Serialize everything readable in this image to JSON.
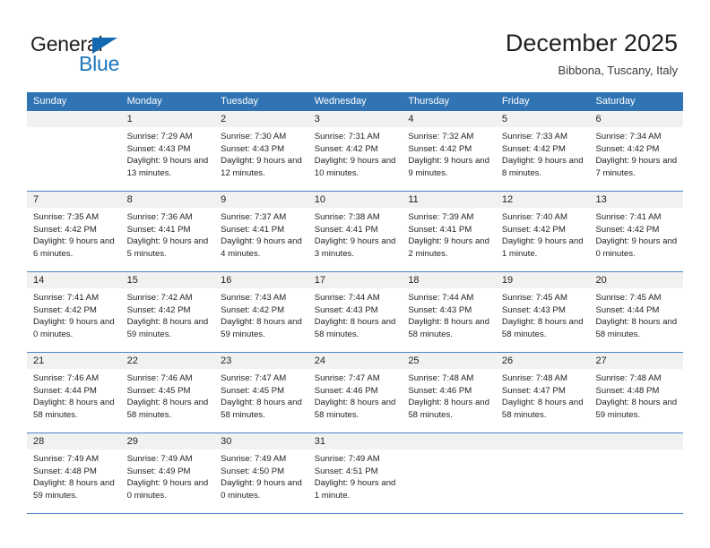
{
  "brand": {
    "name_part1": "General",
    "name_part2": "Blue",
    "triangle_color": "#1268b3",
    "blue_color": "#1b75bb"
  },
  "header": {
    "title": "December 2025",
    "subtitle": "Bibbona, Tuscany, Italy"
  },
  "colors": {
    "header_row_bg": "#3174b4",
    "date_band_bg": "#f1f1f1",
    "row_separator": "#4a86c5",
    "text": "#231f20"
  },
  "weekdays": [
    "Sunday",
    "Monday",
    "Tuesday",
    "Wednesday",
    "Thursday",
    "Friday",
    "Saturday"
  ],
  "weeks": [
    [
      {
        "day": "",
        "sunrise": "",
        "sunset": "",
        "daylight": ""
      },
      {
        "day": "1",
        "sunrise": "Sunrise: 7:29 AM",
        "sunset": "Sunset: 4:43 PM",
        "daylight": "Daylight: 9 hours and 13 minutes."
      },
      {
        "day": "2",
        "sunrise": "Sunrise: 7:30 AM",
        "sunset": "Sunset: 4:43 PM",
        "daylight": "Daylight: 9 hours and 12 minutes."
      },
      {
        "day": "3",
        "sunrise": "Sunrise: 7:31 AM",
        "sunset": "Sunset: 4:42 PM",
        "daylight": "Daylight: 9 hours and 10 minutes."
      },
      {
        "day": "4",
        "sunrise": "Sunrise: 7:32 AM",
        "sunset": "Sunset: 4:42 PM",
        "daylight": "Daylight: 9 hours and 9 minutes."
      },
      {
        "day": "5",
        "sunrise": "Sunrise: 7:33 AM",
        "sunset": "Sunset: 4:42 PM",
        "daylight": "Daylight: 9 hours and 8 minutes."
      },
      {
        "day": "6",
        "sunrise": "Sunrise: 7:34 AM",
        "sunset": "Sunset: 4:42 PM",
        "daylight": "Daylight: 9 hours and 7 minutes."
      }
    ],
    [
      {
        "day": "7",
        "sunrise": "Sunrise: 7:35 AM",
        "sunset": "Sunset: 4:42 PM",
        "daylight": "Daylight: 9 hours and 6 minutes."
      },
      {
        "day": "8",
        "sunrise": "Sunrise: 7:36 AM",
        "sunset": "Sunset: 4:41 PM",
        "daylight": "Daylight: 9 hours and 5 minutes."
      },
      {
        "day": "9",
        "sunrise": "Sunrise: 7:37 AM",
        "sunset": "Sunset: 4:41 PM",
        "daylight": "Daylight: 9 hours and 4 minutes."
      },
      {
        "day": "10",
        "sunrise": "Sunrise: 7:38 AM",
        "sunset": "Sunset: 4:41 PM",
        "daylight": "Daylight: 9 hours and 3 minutes."
      },
      {
        "day": "11",
        "sunrise": "Sunrise: 7:39 AM",
        "sunset": "Sunset: 4:41 PM",
        "daylight": "Daylight: 9 hours and 2 minutes."
      },
      {
        "day": "12",
        "sunrise": "Sunrise: 7:40 AM",
        "sunset": "Sunset: 4:42 PM",
        "daylight": "Daylight: 9 hours and 1 minute."
      },
      {
        "day": "13",
        "sunrise": "Sunrise: 7:41 AM",
        "sunset": "Sunset: 4:42 PM",
        "daylight": "Daylight: 9 hours and 0 minutes."
      }
    ],
    [
      {
        "day": "14",
        "sunrise": "Sunrise: 7:41 AM",
        "sunset": "Sunset: 4:42 PM",
        "daylight": "Daylight: 9 hours and 0 minutes."
      },
      {
        "day": "15",
        "sunrise": "Sunrise: 7:42 AM",
        "sunset": "Sunset: 4:42 PM",
        "daylight": "Daylight: 8 hours and 59 minutes."
      },
      {
        "day": "16",
        "sunrise": "Sunrise: 7:43 AM",
        "sunset": "Sunset: 4:42 PM",
        "daylight": "Daylight: 8 hours and 59 minutes."
      },
      {
        "day": "17",
        "sunrise": "Sunrise: 7:44 AM",
        "sunset": "Sunset: 4:43 PM",
        "daylight": "Daylight: 8 hours and 58 minutes."
      },
      {
        "day": "18",
        "sunrise": "Sunrise: 7:44 AM",
        "sunset": "Sunset: 4:43 PM",
        "daylight": "Daylight: 8 hours and 58 minutes."
      },
      {
        "day": "19",
        "sunrise": "Sunrise: 7:45 AM",
        "sunset": "Sunset: 4:43 PM",
        "daylight": "Daylight: 8 hours and 58 minutes."
      },
      {
        "day": "20",
        "sunrise": "Sunrise: 7:45 AM",
        "sunset": "Sunset: 4:44 PM",
        "daylight": "Daylight: 8 hours and 58 minutes."
      }
    ],
    [
      {
        "day": "21",
        "sunrise": "Sunrise: 7:46 AM",
        "sunset": "Sunset: 4:44 PM",
        "daylight": "Daylight: 8 hours and 58 minutes."
      },
      {
        "day": "22",
        "sunrise": "Sunrise: 7:46 AM",
        "sunset": "Sunset: 4:45 PM",
        "daylight": "Daylight: 8 hours and 58 minutes."
      },
      {
        "day": "23",
        "sunrise": "Sunrise: 7:47 AM",
        "sunset": "Sunset: 4:45 PM",
        "daylight": "Daylight: 8 hours and 58 minutes."
      },
      {
        "day": "24",
        "sunrise": "Sunrise: 7:47 AM",
        "sunset": "Sunset: 4:46 PM",
        "daylight": "Daylight: 8 hours and 58 minutes."
      },
      {
        "day": "25",
        "sunrise": "Sunrise: 7:48 AM",
        "sunset": "Sunset: 4:46 PM",
        "daylight": "Daylight: 8 hours and 58 minutes."
      },
      {
        "day": "26",
        "sunrise": "Sunrise: 7:48 AM",
        "sunset": "Sunset: 4:47 PM",
        "daylight": "Daylight: 8 hours and 58 minutes."
      },
      {
        "day": "27",
        "sunrise": "Sunrise: 7:48 AM",
        "sunset": "Sunset: 4:48 PM",
        "daylight": "Daylight: 8 hours and 59 minutes."
      }
    ],
    [
      {
        "day": "28",
        "sunrise": "Sunrise: 7:49 AM",
        "sunset": "Sunset: 4:48 PM",
        "daylight": "Daylight: 8 hours and 59 minutes."
      },
      {
        "day": "29",
        "sunrise": "Sunrise: 7:49 AM",
        "sunset": "Sunset: 4:49 PM",
        "daylight": "Daylight: 9 hours and 0 minutes."
      },
      {
        "day": "30",
        "sunrise": "Sunrise: 7:49 AM",
        "sunset": "Sunset: 4:50 PM",
        "daylight": "Daylight: 9 hours and 0 minutes."
      },
      {
        "day": "31",
        "sunrise": "Sunrise: 7:49 AM",
        "sunset": "Sunset: 4:51 PM",
        "daylight": "Daylight: 9 hours and 1 minute."
      },
      {
        "day": "",
        "sunrise": "",
        "sunset": "",
        "daylight": ""
      },
      {
        "day": "",
        "sunrise": "",
        "sunset": "",
        "daylight": ""
      },
      {
        "day": "",
        "sunrise": "",
        "sunset": "",
        "daylight": ""
      }
    ]
  ]
}
